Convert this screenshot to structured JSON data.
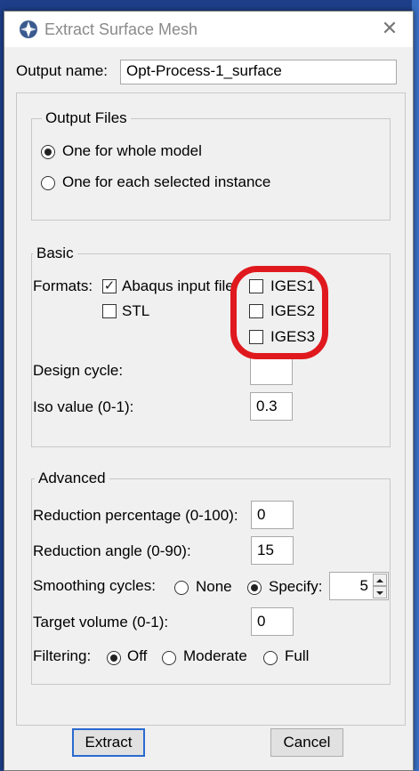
{
  "colors": {
    "highlight_ring": "#e0191e",
    "default_button_border": "#2a6ad0"
  },
  "window": {
    "title": "Extract Surface Mesh",
    "app_icon": "abaqus-app-icon",
    "close_icon": "close-x-icon"
  },
  "output_name": {
    "label": "Output name:",
    "value": "Opt-Process-1_surface"
  },
  "output_files": {
    "legend": "Output Files",
    "option_whole": "One for whole model",
    "option_each": "One for each selected instance",
    "selected": "One for whole model"
  },
  "basic": {
    "legend": "Basic",
    "formats_label": "Formats:",
    "fmt_abaqus": "Abaqus input file",
    "fmt_abaqus_checked": true,
    "fmt_stl": "STL",
    "fmt_stl_checked": false,
    "fmt_iges1": "IGES1",
    "fmt_iges2": "IGES2",
    "fmt_iges3": "IGES3",
    "design_cycle_label": "Design cycle:",
    "design_cycle_value": "",
    "iso_label": "Iso value (0-1):",
    "iso_value": "0.3"
  },
  "advanced": {
    "legend": "Advanced",
    "reduction_pct_label": "Reduction percentage (0-100):",
    "reduction_pct_value": "0",
    "reduction_angle_label": "Reduction angle (0-90):",
    "reduction_angle_value": "15",
    "smoothing_label": "Smoothing cycles:",
    "smoothing_none": "None",
    "smoothing_specify": "Specify:",
    "smoothing_value": "5",
    "smoothing_selected": "Specify:",
    "target_volume_label": "Target volume (0-1):",
    "target_volume_value": "0",
    "filtering_label": "Filtering:",
    "filter_off": "Off",
    "filter_moderate": "Moderate",
    "filter_full": "Full",
    "filter_selected": "Off"
  },
  "buttons": {
    "extract": "Extract",
    "cancel": "Cancel"
  }
}
